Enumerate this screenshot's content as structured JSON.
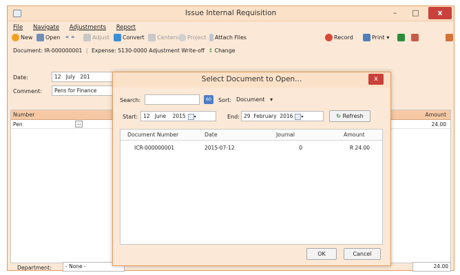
{
  "window": {
    "title": "Issue Internal Requisition",
    "minimize": "–",
    "maximize": "□",
    "close": "x"
  },
  "menu": [
    "File",
    "Navigate",
    "Adjustments",
    "Report"
  ],
  "toolbar": {
    "new": "New",
    "open": "Open",
    "adjust": "Adjust",
    "convert": "Convert",
    "centers": "Centers",
    "project": "Project",
    "attach": "Attach Files",
    "record": "Record",
    "print": "Print"
  },
  "docline": {
    "document_label": "Document:",
    "document_value": "IR-000000001",
    "expense_label": "Expense:",
    "expense_value": "5130-0000 Adjustment Write-off",
    "change": "Change"
  },
  "form": {
    "date_label": "Date:",
    "date_day": "12",
    "date_month": "July",
    "date_year": "201",
    "comment_label": "Comment:",
    "comment_value": "Pens for Finance"
  },
  "grid": {
    "col_number": "Number",
    "col_amount": "Amount",
    "rows": [
      {
        "number": "Pen",
        "amount": "24.00",
        "lookup": "..."
      }
    ]
  },
  "footer": {
    "department_label": "Department:",
    "department_value": "- None -",
    "total": "24.00"
  },
  "dialog": {
    "title": "Select Document to Open...",
    "close": "x",
    "search_label": "Search:",
    "search_value": "",
    "search_btn": "60",
    "sort_label": "Sort:",
    "sort_value": "Document",
    "start_label": "Start:",
    "start_day": "12",
    "start_month": "June",
    "start_year": "2015",
    "end_label": "End:",
    "end_day": "29",
    "end_month": "February",
    "end_year": "2016",
    "refresh": "Refresh",
    "headers": {
      "number": "Document Number",
      "date": "Date",
      "journal": "Journal",
      "amount": "Amount"
    },
    "rows": [
      {
        "number": "ICR-000000001",
        "date": "2015-07-12",
        "journal": "0",
        "amount": "R 24.00"
      }
    ],
    "ok": "OK",
    "cancel": "Cancel"
  },
  "colors": {
    "accent": "#e39a5c",
    "header": "#f6c9a4",
    "close": "#c9413a",
    "background": "#fbe8d6"
  }
}
